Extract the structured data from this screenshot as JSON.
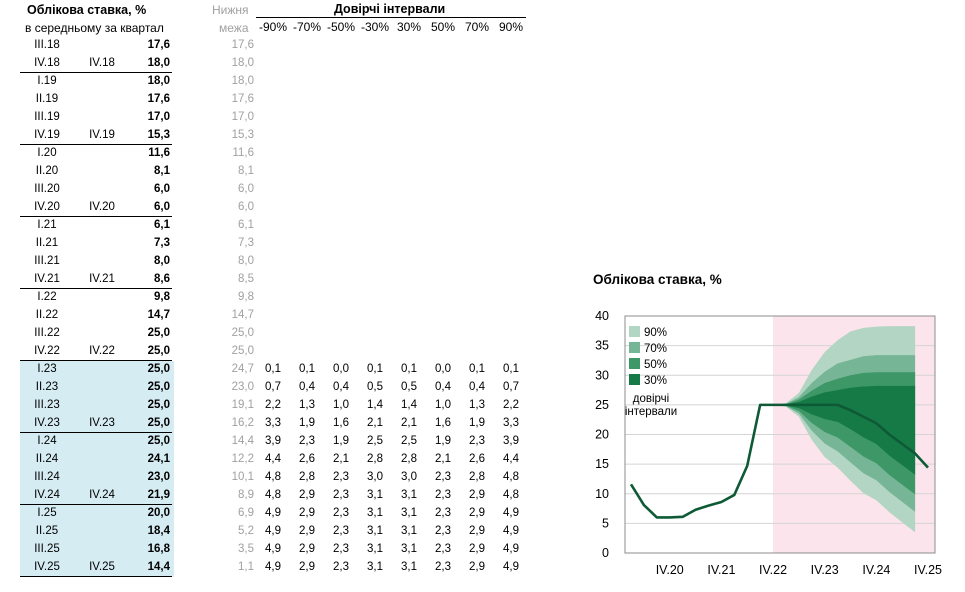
{
  "header": {
    "title": "Облікова ставка, %",
    "subtitle": "в середньому за квартал",
    "lower_top": "Нижня",
    "lower_bottom": "межа",
    "ci_title": "Довірчі інтервали",
    "ci_columns": [
      "-90%",
      "-70%",
      "-50%",
      "-30%",
      "30%",
      "50%",
      "70%",
      "90%"
    ]
  },
  "rows": [
    {
      "q": "III.18",
      "ann": "",
      "rate": "17,6",
      "low": "17,6",
      "ci": []
    },
    {
      "q": "IV.18",
      "ann": "IV.18",
      "rate": "18,0",
      "low": "18,0",
      "ci": []
    },
    {
      "q": "I.19",
      "ann": "",
      "rate": "18,0",
      "low": "18,0",
      "ci": []
    },
    {
      "q": "II.19",
      "ann": "",
      "rate": "17,6",
      "low": "17,6",
      "ci": []
    },
    {
      "q": "III.19",
      "ann": "",
      "rate": "17,0",
      "low": "17,0",
      "ci": []
    },
    {
      "q": "IV.19",
      "ann": "IV.19",
      "rate": "15,3",
      "low": "15,3",
      "ci": []
    },
    {
      "q": "I.20",
      "ann": "",
      "rate": "11,6",
      "low": "11,6",
      "ci": []
    },
    {
      "q": "II.20",
      "ann": "",
      "rate": "8,1",
      "low": "8,1",
      "ci": []
    },
    {
      "q": "III.20",
      "ann": "",
      "rate": "6,0",
      "low": "6,0",
      "ci": []
    },
    {
      "q": "IV.20",
      "ann": "IV.20",
      "rate": "6,0",
      "low": "6,0",
      "ci": []
    },
    {
      "q": "I.21",
      "ann": "",
      "rate": "6,1",
      "low": "6,1",
      "ci": []
    },
    {
      "q": "II.21",
      "ann": "",
      "rate": "7,3",
      "low": "7,3",
      "ci": []
    },
    {
      "q": "III.21",
      "ann": "",
      "rate": "8,0",
      "low": "8,0",
      "ci": []
    },
    {
      "q": "IV.21",
      "ann": "IV.21",
      "rate": "8,6",
      "low": "8,5",
      "ci": []
    },
    {
      "q": "I.22",
      "ann": "",
      "rate": "9,8",
      "low": "9,8",
      "ci": []
    },
    {
      "q": "II.22",
      "ann": "",
      "rate": "14,7",
      "low": "14,7",
      "ci": []
    },
    {
      "q": "III.22",
      "ann": "",
      "rate": "25,0",
      "low": "25,0",
      "ci": []
    },
    {
      "q": "IV.22",
      "ann": "IV.22",
      "rate": "25,0",
      "low": "25,0",
      "ci": []
    },
    {
      "q": "I.23",
      "ann": "",
      "rate": "25,0",
      "low": "24,7",
      "ci": [
        "0,1",
        "0,1",
        "0,0",
        "0,1",
        "0,1",
        "0,0",
        "0,1",
        "0,1"
      ]
    },
    {
      "q": "II.23",
      "ann": "",
      "rate": "25,0",
      "low": "23,0",
      "ci": [
        "0,7",
        "0,4",
        "0,4",
        "0,5",
        "0,5",
        "0,4",
        "0,4",
        "0,7"
      ]
    },
    {
      "q": "III.23",
      "ann": "",
      "rate": "25,0",
      "low": "19,1",
      "ci": [
        "2,2",
        "1,3",
        "1,0",
        "1,4",
        "1,4",
        "1,0",
        "1,3",
        "2,2"
      ]
    },
    {
      "q": "IV.23",
      "ann": "IV.23",
      "rate": "25,0",
      "low": "16,2",
      "ci": [
        "3,3",
        "1,9",
        "1,6",
        "2,1",
        "2,1",
        "1,6",
        "1,9",
        "3,3"
      ]
    },
    {
      "q": "I.24",
      "ann": "",
      "rate": "25,0",
      "low": "14,4",
      "ci": [
        "3,9",
        "2,3",
        "1,9",
        "2,5",
        "2,5",
        "1,9",
        "2,3",
        "3,9"
      ]
    },
    {
      "q": "II.24",
      "ann": "",
      "rate": "24,1",
      "low": "12,2",
      "ci": [
        "4,4",
        "2,6",
        "2,1",
        "2,8",
        "2,8",
        "2,1",
        "2,6",
        "4,4"
      ]
    },
    {
      "q": "III.24",
      "ann": "",
      "rate": "23,0",
      "low": "10,1",
      "ci": [
        "4,8",
        "2,8",
        "2,3",
        "3,0",
        "3,0",
        "2,3",
        "2,8",
        "4,8"
      ]
    },
    {
      "q": "IV.24",
      "ann": "IV.24",
      "rate": "21,9",
      "low": "8,9",
      "ci": [
        "4,8",
        "2,9",
        "2,3",
        "3,1",
        "3,1",
        "2,3",
        "2,9",
        "4,8"
      ]
    },
    {
      "q": "I.25",
      "ann": "",
      "rate": "20,0",
      "low": "6,9",
      "ci": [
        "4,9",
        "2,9",
        "2,3",
        "3,1",
        "3,1",
        "2,3",
        "2,9",
        "4,9"
      ]
    },
    {
      "q": "II.25",
      "ann": "",
      "rate": "18,4",
      "low": "5,2",
      "ci": [
        "4,9",
        "2,9",
        "2,3",
        "3,1",
        "3,1",
        "2,3",
        "2,9",
        "4,9"
      ]
    },
    {
      "q": "III.25",
      "ann": "",
      "rate": "16,8",
      "low": "3,5",
      "ci": [
        "4,9",
        "2,9",
        "2,3",
        "3,1",
        "3,1",
        "2,3",
        "2,9",
        "4,9"
      ]
    },
    {
      "q": "IV.25",
      "ann": "IV.25",
      "rate": "14,4",
      "low": "1,1",
      "ci": [
        "4,9",
        "2,9",
        "2,3",
        "3,1",
        "3,1",
        "2,3",
        "2,9",
        "4,9"
      ]
    }
  ],
  "chart_data": {
    "type": "area",
    "title": "Облікова ставка, %",
    "x_ticks": [
      "IV.20",
      "IV.21",
      "IV.22",
      "IV.23",
      "IV.24",
      "IV.25"
    ],
    "ylim": [
      0,
      40
    ],
    "y_ticks": [
      0,
      5,
      10,
      15,
      20,
      25,
      30,
      35,
      40
    ],
    "legend": [
      "90%",
      "70%",
      "50%",
      "30%"
    ],
    "legend_note": [
      "довірчі",
      "інтервали"
    ],
    "legend_position": "top-left",
    "forecast_start": "IV.22",
    "colors": {
      "line": "#0e5a36",
      "ci30": "#167a47",
      "ci50": "#3d9766",
      "ci70": "#76b596",
      "ci90": "#b3d5c3",
      "forecast_bg": "#fbe4ec"
    },
    "x": [
      "I.20",
      "II.20",
      "III.20",
      "IV.20",
      "I.21",
      "II.21",
      "III.21",
      "IV.21",
      "I.22",
      "II.22",
      "III.22",
      "IV.22",
      "I.23",
      "II.23",
      "III.23",
      "IV.23",
      "I.24",
      "II.24",
      "III.24",
      "IV.24",
      "I.25",
      "II.25",
      "III.25",
      "IV.25"
    ],
    "series": [
      {
        "values": [
          11.6,
          8.1,
          6.0,
          6.0,
          6.1,
          7.3,
          8.0,
          8.6,
          9.8,
          14.7,
          25.0,
          25.0,
          25.0,
          25.0,
          25.0,
          25.0,
          25.0,
          24.1,
          23.0,
          21.9,
          20.0,
          18.4,
          16.8,
          14.4
        ]
      }
    ],
    "bands_upper": {
      "start": "IV.22",
      "ci30": [
        25.0,
        25.1,
        25.5,
        26.4,
        27.1,
        27.5,
        27.9,
        28.1,
        28.2,
        28.2,
        28.2,
        28.2
      ],
      "ci50": [
        25.0,
        25.1,
        25.9,
        27.4,
        28.7,
        29.4,
        30.0,
        30.4,
        30.5,
        30.5,
        30.5,
        30.5
      ],
      "ci70": [
        25.0,
        25.2,
        26.3,
        28.7,
        30.6,
        32.0,
        32.6,
        33.2,
        33.4,
        33.4,
        33.4,
        33.4
      ],
      "ci90": [
        25.0,
        25.3,
        27.0,
        30.9,
        33.9,
        35.9,
        37.4,
        38.0,
        38.2,
        38.3,
        38.3,
        38.3
      ]
    },
    "bands_lower": {
      "start": "IV.22",
      "ci30": [
        25.0,
        24.7,
        23.0,
        19.1,
        16.2,
        14.4,
        12.2,
        10.1,
        8.9,
        6.9,
        5.2,
        3.5
      ],
      "ci50": [
        25.0,
        24.7,
        23.0,
        19.1,
        16.2,
        14.4,
        12.2,
        10.1,
        8.9,
        6.9,
        5.2,
        3.5
      ],
      "ci70": [
        25.0,
        24.7,
        23.0,
        19.1,
        16.2,
        14.4,
        12.2,
        10.1,
        8.9,
        6.9,
        5.2,
        3.5
      ],
      "ci90": [
        25.0,
        24.7,
        23.0,
        19.1,
        16.2,
        14.4,
        12.2,
        10.1,
        8.9,
        6.9,
        5.2,
        3.5
      ]
    }
  }
}
